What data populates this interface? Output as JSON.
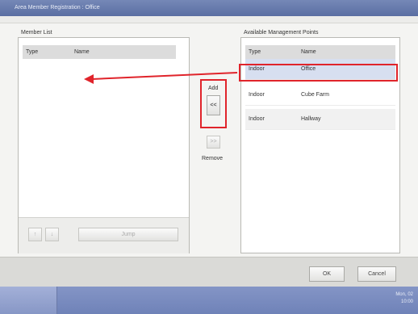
{
  "window": {
    "title": "Area Member Registration : Office"
  },
  "member_list": {
    "label": "Member List",
    "columns": [
      "Type",
      "Name"
    ],
    "rows": [],
    "up_label": "↑",
    "down_label": "↓",
    "jump_label": "Jump"
  },
  "available": {
    "label": "Available Management Points",
    "columns": [
      "Type",
      "Name"
    ],
    "rows": [
      {
        "type": "Indoor",
        "name": "Office"
      },
      {
        "type": "Indoor",
        "name": "Cube Farm"
      },
      {
        "type": "Indoor",
        "name": "Hallway"
      }
    ]
  },
  "transfer": {
    "add_label": "Add",
    "add_symbol": "<<",
    "remove_symbol": ">>",
    "remove_label": "Remove"
  },
  "footer": {
    "ok_label": "OK",
    "cancel_label": "Cancel"
  },
  "taskbar": {
    "clock_day": "Mon, 02",
    "clock_time": "10:00"
  },
  "colors": {
    "highlight": "#e0242b",
    "title_bar": "#6a7db0",
    "selected_row": "#d7dff0"
  }
}
